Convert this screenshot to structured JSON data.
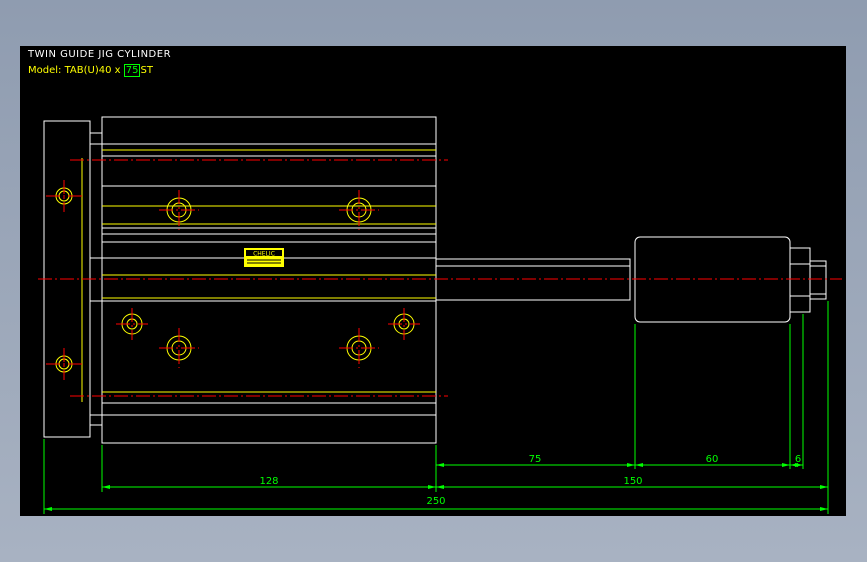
{
  "title": "TWIN GUIDE JIG CYLINDER",
  "model": {
    "label": "Model:",
    "code_prefix": "TAB(U)40 x ",
    "stroke": "75",
    "suffix": "ST"
  },
  "logo_text": "CHELIC",
  "dimensions": {
    "d75": "75",
    "d60": "60",
    "d6": "6",
    "d128": "128",
    "d150": "150",
    "d250": "250"
  },
  "colors": {
    "background": "#000000",
    "outline": "#ffffff",
    "detail": "#ffff00",
    "centerline": "#ff0000",
    "dimension": "#00ff00"
  }
}
